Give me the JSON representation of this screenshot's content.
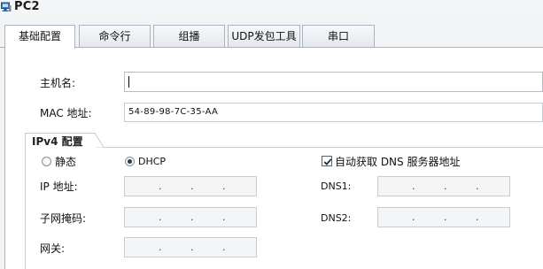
{
  "window": {
    "title": "PC2",
    "icon": "pc-monitor-icon"
  },
  "tabs": [
    {
      "label": "基础配置",
      "active": true
    },
    {
      "label": "命令行",
      "active": false
    },
    {
      "label": "组播",
      "active": false
    },
    {
      "label": "UDP发包工具",
      "active": false
    },
    {
      "label": "串口",
      "active": false
    }
  ],
  "basic": {
    "hostname_label": "主机名:",
    "hostname_value": "",
    "mac_label": "MAC 地址:",
    "mac_value": "54-89-98-7C-35-AA"
  },
  "ipv4": {
    "group_title": "IPv4 配置",
    "mode_static_label": "静态",
    "mode_dhcp_label": "DHCP",
    "mode_selected": "DHCP",
    "auto_dns_label": "自动获取 DNS 服务器地址",
    "auto_dns_checked": true,
    "ip_label": "IP 地址:",
    "mask_label": "子网掩码:",
    "gateway_label": "网关:",
    "dns1_label": "DNS1:",
    "dns2_label": "DNS2:",
    "ip_value": "",
    "mask_value": "",
    "gateway_value": "",
    "dns1_value": "",
    "dns2_value": "",
    "separator": "."
  },
  "colors": {
    "tab_border": "#a8b4c2",
    "panel_bg": "#ffffff",
    "window_bg": "#f1f3f5",
    "disabled_field_bg": "#f4f5f6",
    "icon_blue": "#2d6db5"
  }
}
